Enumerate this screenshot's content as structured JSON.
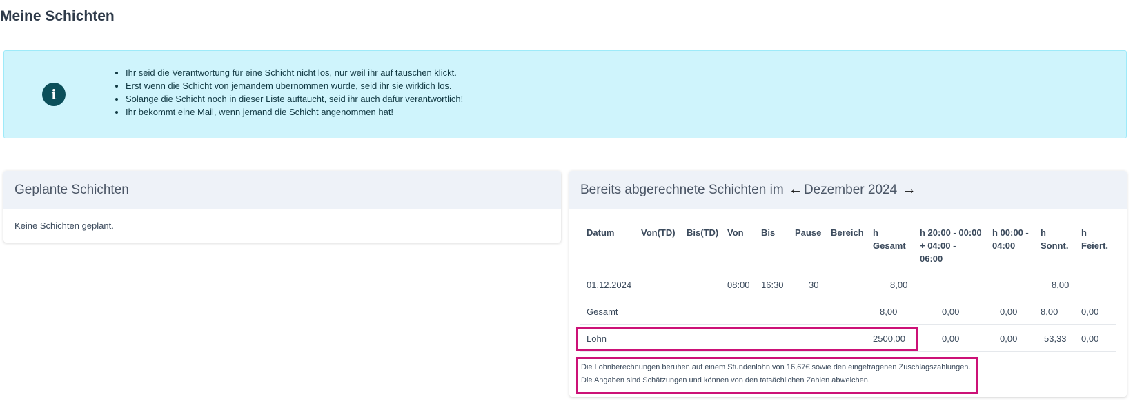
{
  "page": {
    "title": "Meine Schichten"
  },
  "alert": {
    "icon": "info-icon",
    "items": [
      "Ihr seid die Verantwortung für eine Schicht nicht los, nur weil ihr auf tauschen klickt.",
      "Erst wenn die Schicht von jemandem übernommen wurde, seid ihr sie wirklich los.",
      "Solange die Schicht noch in dieser Liste auftaucht, seid ihr auch dafür verantwortlich!",
      "Ihr bekommt eine Mail, wenn jemand die Schicht angenommen hat!"
    ],
    "colors": {
      "background": "#cff4fc",
      "icon": "#0b4f5a"
    }
  },
  "planned": {
    "title": "Geplante Schichten",
    "empty_text": "Keine Schichten geplant."
  },
  "billed": {
    "title_prefix": "Bereits abgerechnete Schichten im",
    "prev_icon": "←",
    "month": "Dezember 2024",
    "next_icon": "→",
    "columns": {
      "datum": "Datum",
      "von_td": "Von(TD)",
      "bis_td": "Bis(TD)",
      "von": "Von",
      "bis": "Bis",
      "pause": "Pause",
      "bereich": "Bereich",
      "h_gesamt_1": "h",
      "h_gesamt_2": "Gesamt",
      "h_night_1": "h 20:00 - 00:00",
      "h_night_2": "+ 04:00 -",
      "h_night_3": "06:00",
      "h_deep_1": "h 00:00 -",
      "h_deep_2": "04:00",
      "h_sun_1": "h",
      "h_sun_2": "Sonnt.",
      "h_hol_1": "h",
      "h_hol_2": "Feiert."
    },
    "rows": [
      {
        "datum": "01.12.2024",
        "von": "08:00",
        "bis": "16:30",
        "pause": "30",
        "h_gesamt": "8,00",
        "h_sun": "8,00"
      }
    ],
    "total": {
      "label": "Gesamt",
      "h_gesamt": "8,00",
      "h_night": "0,00",
      "h_deep": "0,00",
      "h_sun": "8,00",
      "h_hol": "0,00"
    },
    "wage": {
      "label": "Lohn",
      "h_gesamt": "2500,00",
      "h_night": "0,00",
      "h_deep": "0,00",
      "h_sun": "53,33",
      "h_hol": "0,00"
    },
    "note_1": "Die Lohnberechnungen beruhen auf einem Stundenlohn von 16,67€ sowie den eingetragenen Zuschlagszahlungen.",
    "note_2": "Die Angaben sind Schätzungen und können von den tatsächlichen Zahlen abweichen.",
    "highlight_color": "#cc1177"
  }
}
